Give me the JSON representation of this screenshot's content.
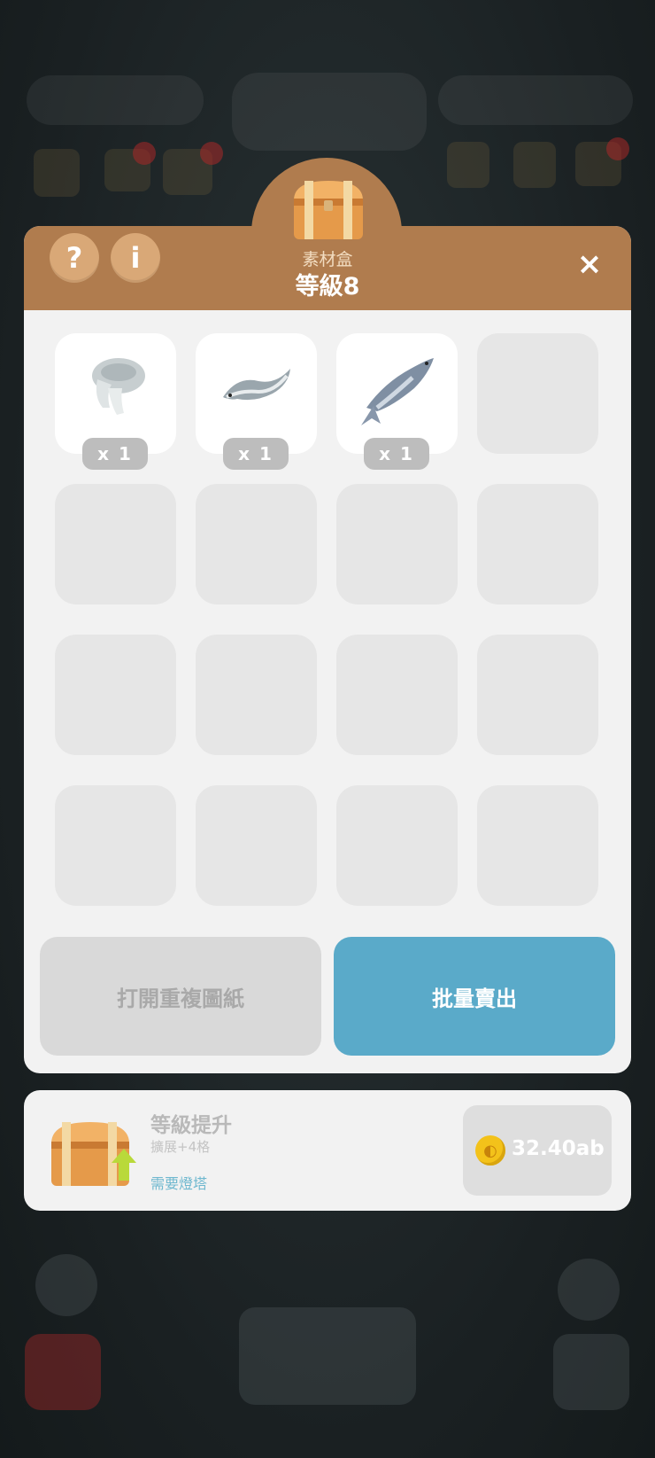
{
  "modal": {
    "subtitle": "素材盒",
    "title": "等級8",
    "help_button": "?",
    "info_button": "i",
    "close_button": "×"
  },
  "items": [
    {
      "name": "squid",
      "qty": "x 1"
    },
    {
      "name": "eel",
      "qty": "x 1"
    },
    {
      "name": "fish",
      "qty": "x 1"
    }
  ],
  "actions": {
    "open_duplicate": "打開重複圖紙",
    "bulk_sell": "批量賣出"
  },
  "upgrade": {
    "title": "等級提升",
    "description": "擴展+4格",
    "requirement": "需要燈塔",
    "cost": "32.40ab"
  },
  "colors": {
    "header": "#b07c4e",
    "primary_button": "#5aaac9",
    "requirement_text": "#6fb8cf",
    "coin": "#f3c21a"
  }
}
